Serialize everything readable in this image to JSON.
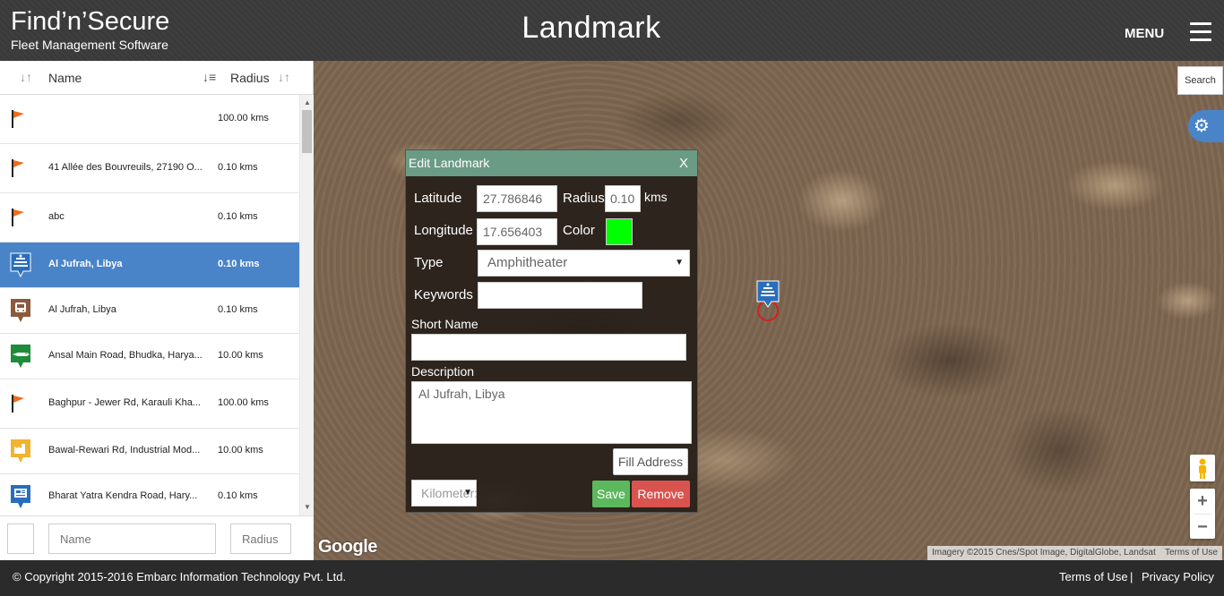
{
  "header": {
    "logo_main": "Find’n’Secure",
    "logo_sub": "Fleet Management Software",
    "title": "Landmark",
    "menu_label": "MENU"
  },
  "list": {
    "col_name": "Name",
    "col_radius": "Radius",
    "rows": [
      {
        "name": "",
        "radius": "100.00 kms",
        "icon": "flag-icon",
        "selected": false
      },
      {
        "name": "41 Allée des Bouvreuils, 27190 O...",
        "radius": "0.10 kms",
        "icon": "flag-icon",
        "selected": false
      },
      {
        "name": "abc",
        "radius": "0.10 kms",
        "icon": "flag-icon",
        "selected": false
      },
      {
        "name": "Al Jufrah, Libya",
        "radius": "0.10 kms",
        "icon": "amphitheater-icon",
        "selected": true
      },
      {
        "name": "Al Jufrah, Libya",
        "radius": "0.10 kms",
        "icon": "bus-stop-icon",
        "selected": false
      },
      {
        "name": "Ansal Main Road, Bhudka, Harya...",
        "radius": "10.00 kms",
        "icon": "crocodile-icon",
        "selected": false
      },
      {
        "name": "Baghpur - Jewer Rd, Karauli Kha...",
        "radius": "100.00 kms",
        "icon": "flag-icon",
        "selected": false
      },
      {
        "name": "Bawal-Rewari Rd, Industrial Mod...",
        "radius": "10.00 kms",
        "icon": "factory-icon",
        "selected": false
      },
      {
        "name": "Bharat Yatra Kendra Road, Hary...",
        "radius": "0.10 kms",
        "icon": "billboard-icon",
        "selected": false
      }
    ],
    "filter_name_placeholder": "Name",
    "filter_radius_placeholder": "Radius"
  },
  "map": {
    "search_label": "Search",
    "google_label": "Google",
    "attribution": "Imagery ©2015 Cnes/Spot Image, DigitalGlobe, Landsat",
    "terms": "Terms of Use",
    "zoom_in": "+",
    "zoom_out": "−"
  },
  "dialog": {
    "title": "Edit Landmark",
    "close": "X",
    "latitude_label": "Latitude",
    "latitude_value": "27.786846",
    "radius_label": "Radius",
    "radius_value": "0.10",
    "radius_unit": "kms",
    "longitude_label": "Longitude",
    "longitude_value": "17.656403",
    "color_label": "Color",
    "color_value": "#00ff00",
    "type_label": "Type",
    "type_value": "Amphitheater",
    "keywords_label": "Keywords",
    "keywords_value": "",
    "short_name_label": "Short Name",
    "short_name_value": "",
    "description_label": "Description",
    "description_value": "Al Jufrah, Libya",
    "fill_address": "Fill Address",
    "unit_select": "Kilometer:",
    "save": "Save",
    "remove": "Remove"
  },
  "footer": {
    "copyright": "© Copyright 2015-2016 Embarc Information Technology Pvt. Ltd.",
    "terms": "Terms of Use",
    "separator": "|",
    "privacy": "Privacy Policy"
  },
  "colors": {
    "selected_row": "#4a84c8",
    "dialog_header": "#6a9b85",
    "save_button": "#5cb85c",
    "remove_button": "#d9534f"
  }
}
